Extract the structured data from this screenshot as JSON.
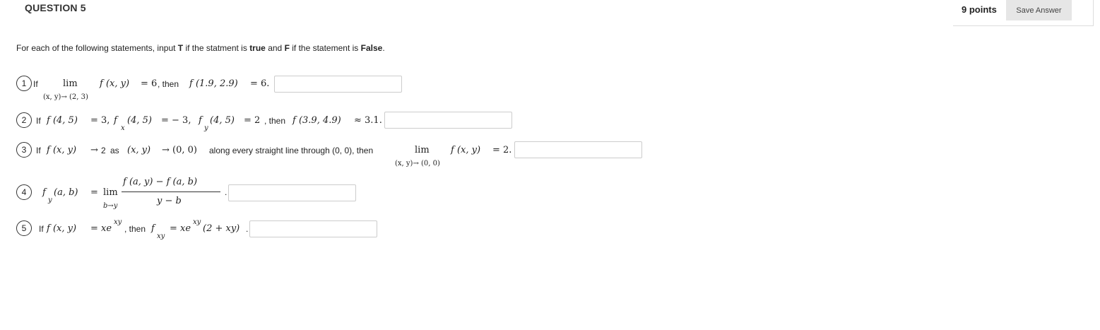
{
  "question": {
    "title": "QUESTION 5",
    "points": "9 points",
    "save_label": "Save Answer"
  },
  "instructions": {
    "p1": "For each of the following statements, input ",
    "t": "T",
    "p2": " if the statment is ",
    "true_word": "true",
    "p3": " and ",
    "f": "F",
    "p4": " if the statement is ",
    "false_word": "False",
    "p5": "."
  },
  "items": [
    {
      "number": "1",
      "if": "If",
      "lim": "lim",
      "lim_under": "(x, y)→ (2, 3)",
      "expr": "f (x, y)",
      "eq": "= 6",
      "then": ", then",
      "expr2": "f (1.9, 2.9)",
      "eq2": "= 6.",
      "answer": "",
      "placeholder": ""
    },
    {
      "number": "2",
      "if": "If",
      "a": "f (4, 5)",
      "a_eq": "= 3,",
      "b": "f",
      "b_sub": "x",
      "b_args": "(4, 5)",
      "b_eq": "= − 3,",
      "c": "f",
      "c_sub": "y",
      "c_args": "(4, 5)",
      "c_eq": "= 2",
      "then": ", then",
      "d": "f (3.9, 4.9)",
      "d_eq": "≈ 3.1.",
      "answer": "",
      "placeholder": ""
    },
    {
      "number": "3",
      "if": "If",
      "a": "f (x, y)",
      "arrow": "→",
      "two": "2",
      "as": "as",
      "b": "(x, y)",
      "arrow2": "→ (0, 0)",
      "along": "along every straight line through (0, 0), then",
      "lim": "lim",
      "lim_under": "(x, y)→ (0, 0)",
      "expr": "f (x, y)",
      "eq": "= 2.",
      "answer": "",
      "placeholder": ""
    },
    {
      "number": "4",
      "f": "f",
      "f_sub": "y",
      "args": "(a, b)",
      "eq": "=",
      "lim": "lim",
      "lim_under": "b→y",
      "num": "f (a, y) − f (a, b)",
      "den": "y − b",
      "dot": ".",
      "answer": "",
      "placeholder": ""
    },
    {
      "number": "5",
      "if": "If",
      "a": "f (x, y)",
      "eq": "= xe",
      "sup": "xy",
      "then": ", then",
      "f": "f",
      "f_sub": "xy",
      "eq2": "= xe",
      "sup2": "xy",
      "rest": "(2 + xy)",
      "dot": ".",
      "answer": "",
      "placeholder": ""
    }
  ]
}
